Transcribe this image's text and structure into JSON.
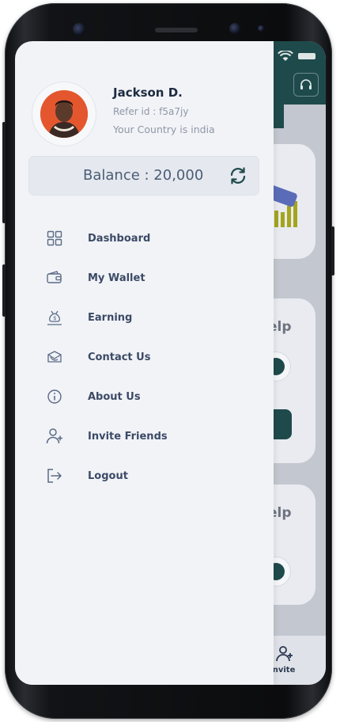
{
  "profile": {
    "name": "Jackson D.",
    "refer_id": "Refer id : f5a7jy",
    "country": "Your Country is india"
  },
  "balance": {
    "text": "Balance : 20,000"
  },
  "menu": [
    {
      "label": "Dashboard",
      "icon": "dashboard-icon"
    },
    {
      "label": "My Wallet",
      "icon": "wallet-icon"
    },
    {
      "label": "Earning",
      "icon": "money-hand-icon"
    },
    {
      "label": "Contact Us",
      "icon": "contact-envelope-icon"
    },
    {
      "label": "About Us",
      "icon": "info-icon"
    },
    {
      "label": "Invite Friends",
      "icon": "add-user-icon"
    },
    {
      "label": "Logout",
      "icon": "logout-icon"
    }
  ],
  "background_app": {
    "help_text_1": "elp",
    "help_text_2": "elp",
    "bottom_nav_invite": "Invite"
  },
  "colors": {
    "accent_teal": "#1f4a4c",
    "drawer_bg": "#f1f3f7",
    "text_dark": "#1d2b3f",
    "menu_text": "#3c4a66"
  }
}
